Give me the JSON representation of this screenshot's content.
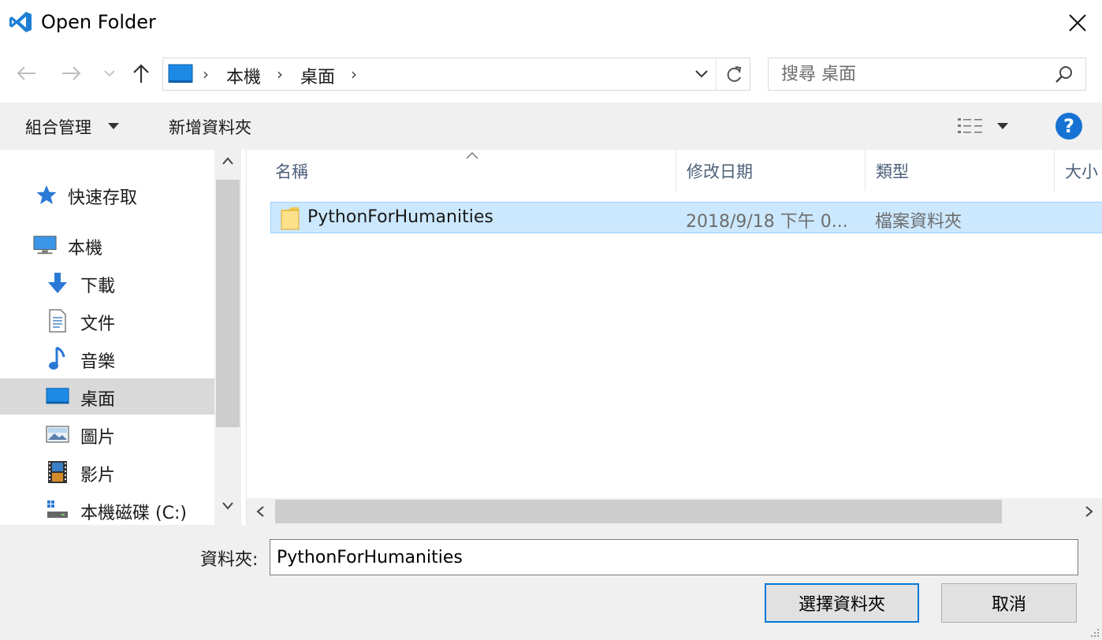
{
  "window": {
    "title": "Open Folder",
    "app_icon": "vscode-icon",
    "close_icon": "close-icon"
  },
  "nav": {
    "back_icon": "arrow-left-icon",
    "forward_icon": "arrow-right-icon",
    "recent_icon": "chevron-down-icon",
    "up_icon": "arrow-up-icon"
  },
  "address": {
    "location_icon": "desktop-icon",
    "breadcrumbs": [
      "本機",
      "桌面"
    ],
    "separator": "›"
  },
  "search": {
    "placeholder": "搜尋 桌面"
  },
  "toolbar": {
    "organize_label": "組合管理",
    "new_folder_label": "新增資料夾",
    "view_icon": "details-view-icon",
    "help_label": "?"
  },
  "navpane": {
    "items": [
      {
        "label": "快速存取",
        "icon": "star-icon"
      },
      {
        "label": "本機",
        "icon": "computer-icon"
      },
      {
        "label": "下載",
        "icon": "download-icon"
      },
      {
        "label": "文件",
        "icon": "document-icon"
      },
      {
        "label": "音樂",
        "icon": "music-icon"
      },
      {
        "label": "桌面",
        "icon": "desktop-icon",
        "selected": true
      },
      {
        "label": "圖片",
        "icon": "pictures-icon"
      },
      {
        "label": "影片",
        "icon": "videos-icon"
      },
      {
        "label": "本機磁碟 (C:)",
        "icon": "drive-icon"
      }
    ]
  },
  "filelist": {
    "columns": [
      "名稱",
      "修改日期",
      "類型",
      "大小"
    ],
    "rows": [
      {
        "name": "PythonForHumanities",
        "modified": "2018/9/18 下午 0...",
        "type": "檔案資料夾",
        "size": "",
        "icon": "folder-icon",
        "selected": true
      }
    ]
  },
  "footer": {
    "folder_label": "資料夾:",
    "folder_value": "PythonForHumanities",
    "select_button": "選擇資料夾",
    "cancel_button": "取消"
  },
  "colors": {
    "accent": "#0078d7",
    "selection_bg": "#cce8ff",
    "selection_border": "#99d1ff",
    "toolbar_bg": "#f0f0f0",
    "help_blue": "#1673d3"
  }
}
